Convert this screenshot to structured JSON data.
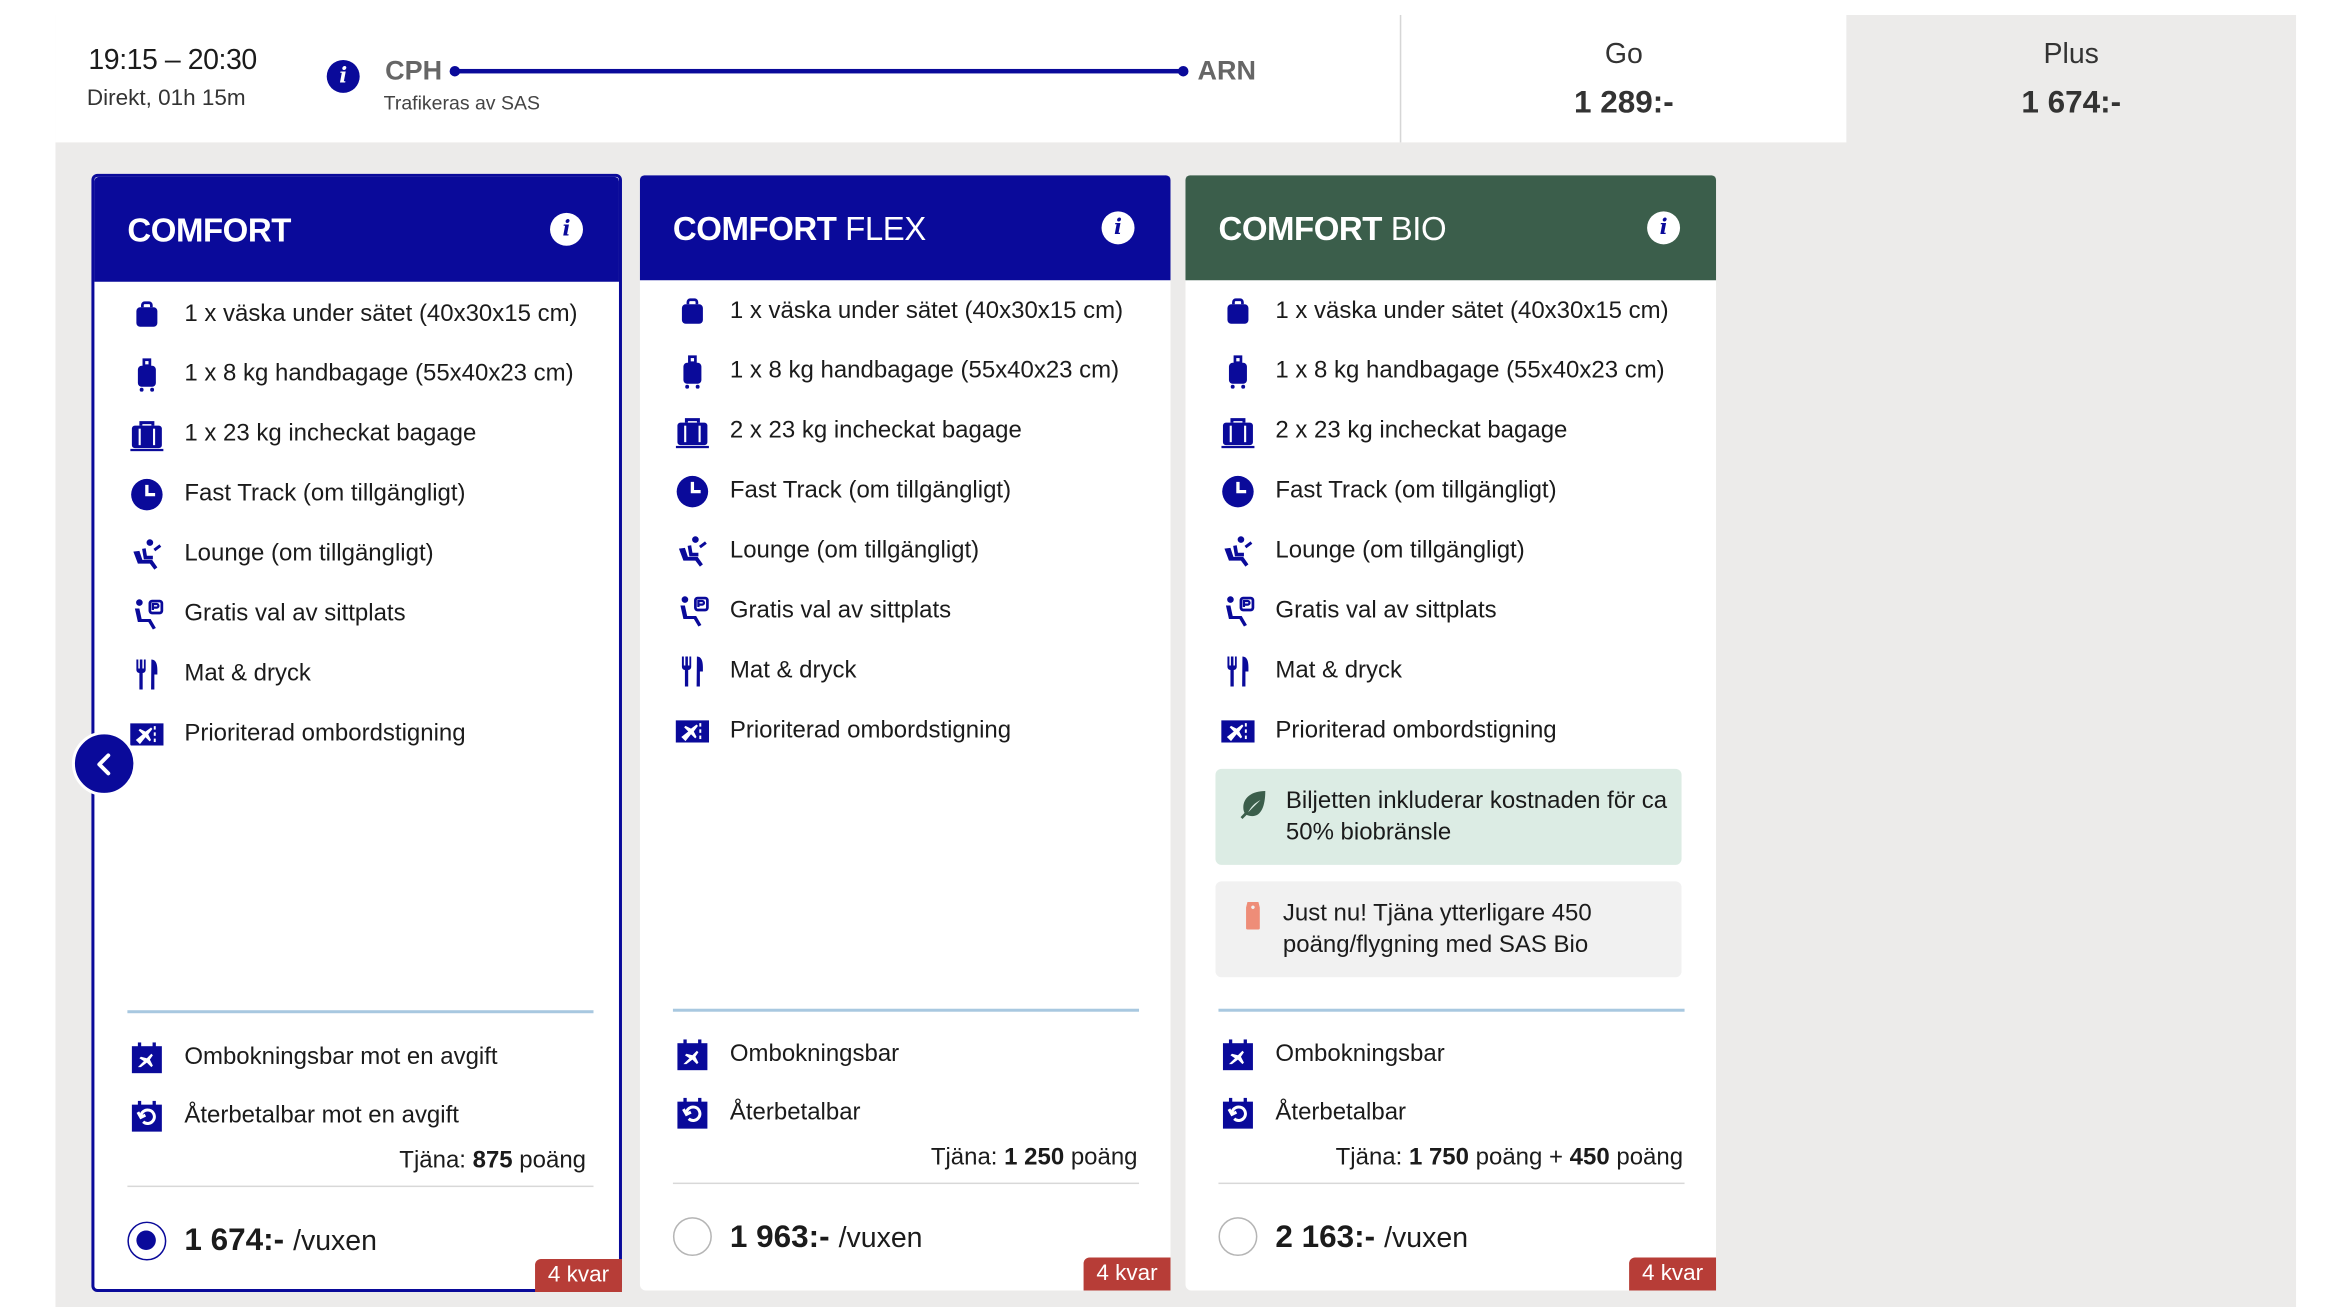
{
  "flight": {
    "time": "19:15 – 20:30",
    "duration": "Direkt, 01h 15m",
    "from": "CPH",
    "to": "ARN",
    "operated_by": "Trafikeras av SAS"
  },
  "fare_tabs": [
    {
      "name": "Go",
      "price": "1 289:-"
    },
    {
      "name": "Plus",
      "price": "1 674:-"
    }
  ],
  "colors": {
    "brand_blue": "#0a0a9a",
    "bio_green": "#3b5e4b",
    "seats_left_red": "#b73d37"
  },
  "cards": [
    {
      "title_bold": "COMFORT",
      "title_light": "",
      "features": [
        {
          "icon": "bag-under-seat-icon",
          "text": "1 x väska under sätet (40x30x15 cm)"
        },
        {
          "icon": "cabin-bag-icon",
          "text": "1 x 8 kg handbagage (55x40x23 cm)"
        },
        {
          "icon": "checked-bag-icon",
          "text": "1 x 23 kg incheckat bagage"
        },
        {
          "icon": "clock-icon",
          "text": "Fast Track (om tillgängligt)"
        },
        {
          "icon": "lounge-icon",
          "text": "Lounge (om tillgängligt)"
        },
        {
          "icon": "seat-icon",
          "text": "Gratis val av sittplats"
        },
        {
          "icon": "cutlery-icon",
          "text": "Mat & dryck"
        },
        {
          "icon": "priority-boarding-icon",
          "text": "Prioriterad ombordstigning"
        }
      ],
      "rebook": "Ombokningsbar mot en avgift",
      "refund": "Återbetalbar mot en avgift",
      "earn_prefix": "Tjäna:",
      "earn_points": "875",
      "earn_suffix": "poäng",
      "price": "1 674:-",
      "per": "/vuxen",
      "seats_left": "4 kvar"
    },
    {
      "title_bold": "COMFORT",
      "title_light": "FLEX",
      "features": [
        {
          "icon": "bag-under-seat-icon",
          "text": "1 x väska under sätet (40x30x15 cm)"
        },
        {
          "icon": "cabin-bag-icon",
          "text": "1 x 8 kg handbagage (55x40x23 cm)"
        },
        {
          "icon": "checked-bag-icon",
          "text": "2 x 23 kg incheckat bagage"
        },
        {
          "icon": "clock-icon",
          "text": "Fast Track (om tillgängligt)"
        },
        {
          "icon": "lounge-icon",
          "text": "Lounge (om tillgängligt)"
        },
        {
          "icon": "seat-icon",
          "text": "Gratis val av sittplats"
        },
        {
          "icon": "cutlery-icon",
          "text": "Mat & dryck"
        },
        {
          "icon": "priority-boarding-icon",
          "text": "Prioriterad ombordstigning"
        }
      ],
      "rebook": "Ombokningsbar",
      "refund": "Återbetalbar",
      "earn_prefix": "Tjäna:",
      "earn_points": "1 250",
      "earn_suffix": "poäng",
      "price": "1 963:-",
      "per": "/vuxen",
      "seats_left": "4 kvar"
    },
    {
      "title_bold": "COMFORT",
      "title_light": "BIO",
      "features": [
        {
          "icon": "bag-under-seat-icon",
          "text": "1 x väska under sätet (40x30x15 cm)"
        },
        {
          "icon": "cabin-bag-icon",
          "text": "1 x 8 kg handbagage (55x40x23 cm)"
        },
        {
          "icon": "checked-bag-icon",
          "text": "2 x 23 kg incheckat bagage"
        },
        {
          "icon": "clock-icon",
          "text": "Fast Track (om tillgängligt)"
        },
        {
          "icon": "lounge-icon",
          "text": "Lounge (om tillgängligt)"
        },
        {
          "icon": "seat-icon",
          "text": "Gratis val av sittplats"
        },
        {
          "icon": "cutlery-icon",
          "text": "Mat & dryck"
        },
        {
          "icon": "priority-boarding-icon",
          "text": "Prioriterad ombordstigning"
        }
      ],
      "bio_note": "Biljetten inkluderar kostnaden för ca 50% biobränsle",
      "bio_points_note": "Just nu! Tjäna ytterligare 450 poäng/flygning med SAS Bio",
      "rebook": "Ombokningsbar",
      "refund": "Återbetalbar",
      "earn_prefix": "Tjäna:",
      "earn_points": "1 750",
      "earn_mid": "poäng +",
      "earn_points2": "450",
      "earn_suffix": "poäng",
      "price": "2 163:-",
      "per": "/vuxen",
      "seats_left": "4 kvar"
    }
  ],
  "nav": {
    "prev_icon": "chevron-left-icon"
  }
}
